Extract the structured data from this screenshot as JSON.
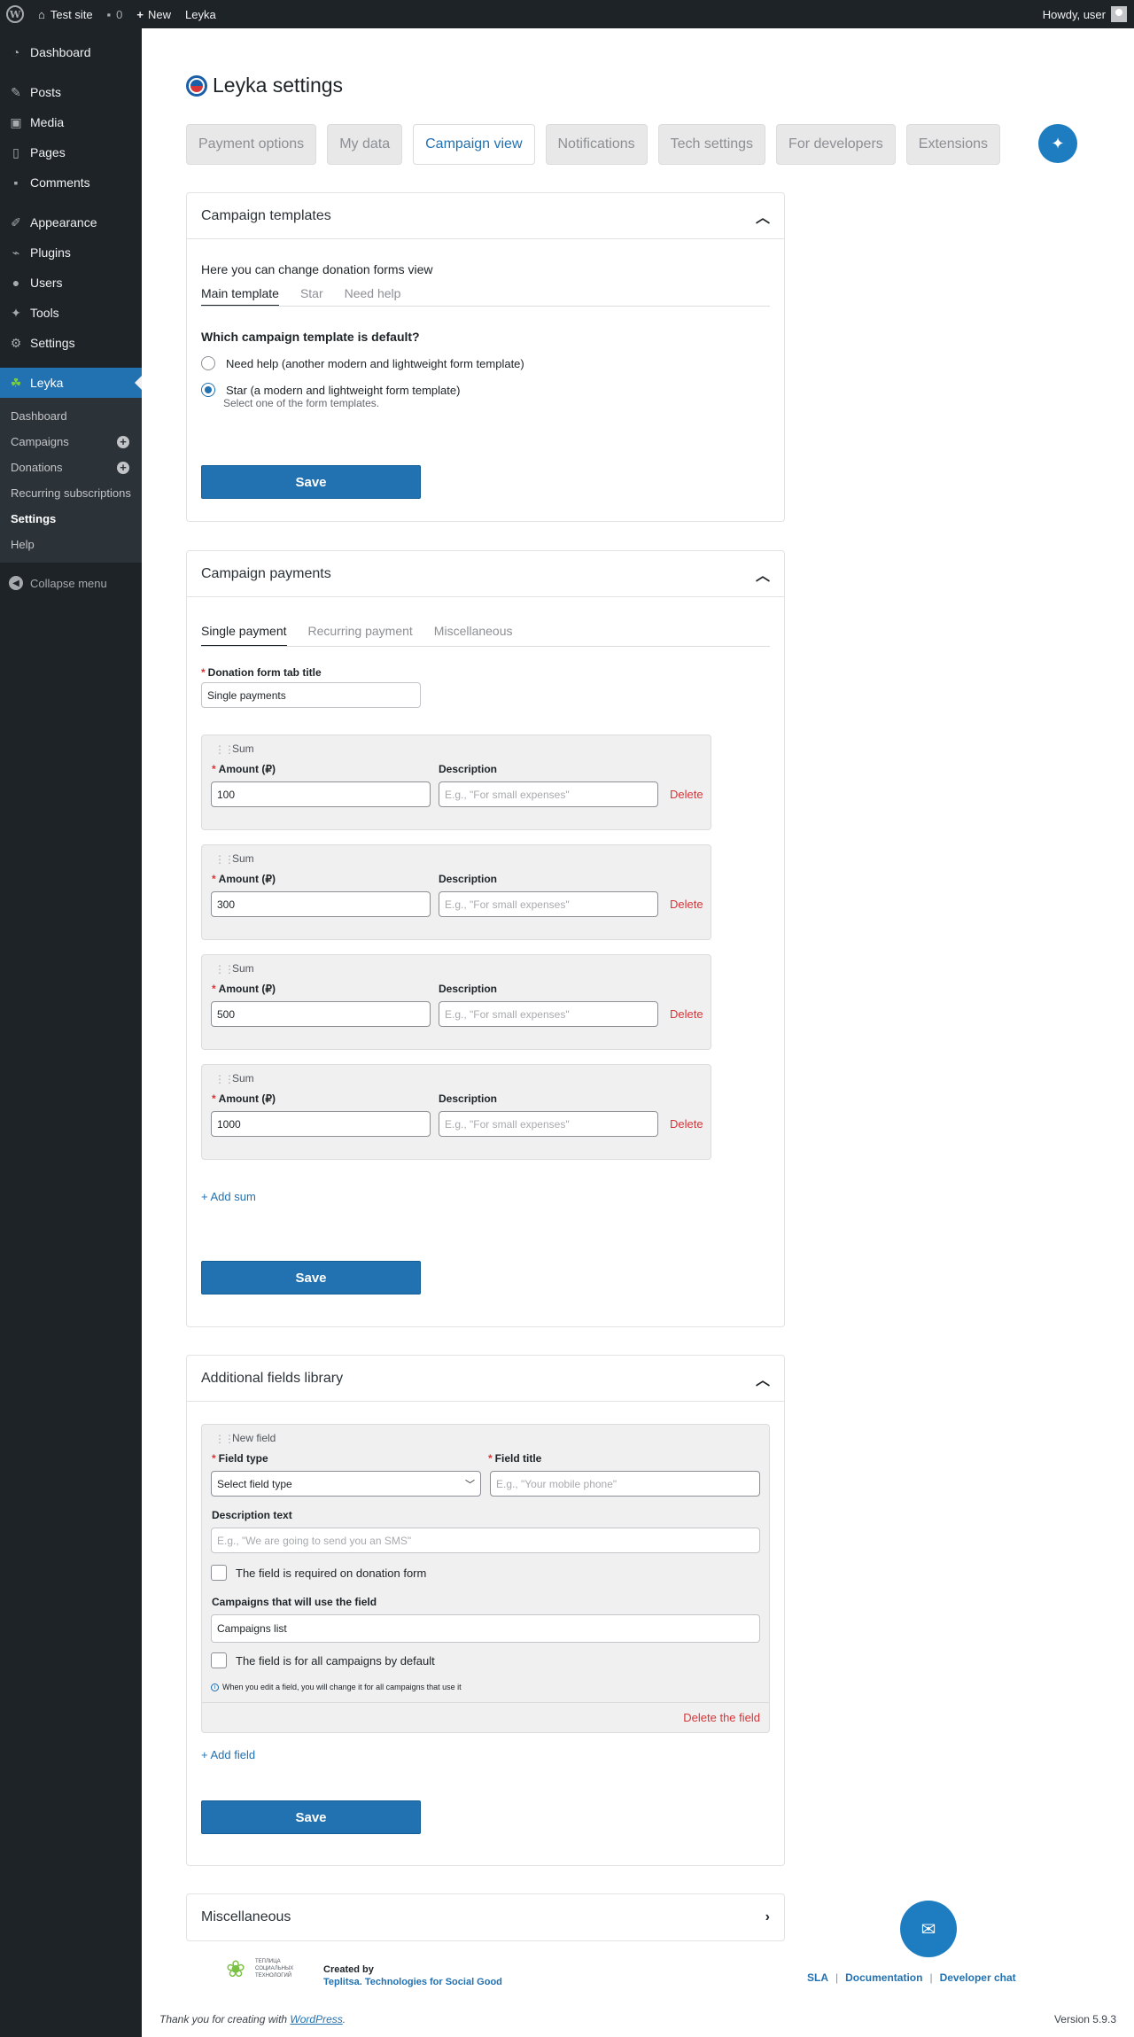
{
  "adminbar": {
    "site_name": "Test site",
    "comments_count": "0",
    "new_label": "New",
    "plugin_label": "Leyka",
    "howdy": "Howdy, user"
  },
  "sidebar": {
    "items": [
      {
        "label": "Dashboard",
        "icon": "dashboard-icon"
      },
      {
        "label": "Posts",
        "icon": "pin-icon"
      },
      {
        "label": "Media",
        "icon": "media-icon"
      },
      {
        "label": "Pages",
        "icon": "page-icon"
      },
      {
        "label": "Comments",
        "icon": "comment-icon"
      },
      {
        "label": "Appearance",
        "icon": "brush-icon"
      },
      {
        "label": "Plugins",
        "icon": "plug-icon"
      },
      {
        "label": "Users",
        "icon": "user-icon"
      },
      {
        "label": "Tools",
        "icon": "wrench-icon"
      },
      {
        "label": "Settings",
        "icon": "settings-icon"
      }
    ],
    "current": {
      "label": "Leyka",
      "icon": "leaf-icon"
    },
    "submenu": [
      "Dashboard",
      "Campaigns",
      "Donations",
      "Recurring subscriptions",
      "Settings",
      "Help"
    ],
    "collapse": "Collapse menu"
  },
  "page": {
    "title": "Leyka settings",
    "tabs": [
      "Payment options",
      "My data",
      "Campaign view",
      "Notifications",
      "Tech settings",
      "For developers",
      "Extensions"
    ],
    "active_tab": "Campaign view"
  },
  "templates": {
    "title": "Campaign templates",
    "intro": "Here you can change donation forms view",
    "subtabs": [
      "Main template",
      "Star",
      "Need help"
    ],
    "question": "Which campaign template is default?",
    "options": [
      "Need help (another modern and lightweight form template)",
      "Star (a modern and lightweight form template)"
    ],
    "selected_index": 1,
    "hint": "Select one of the form templates.",
    "save": "Save"
  },
  "payments": {
    "title": "Campaign payments",
    "subtabs": [
      "Single payment",
      "Recurring payment",
      "Miscellaneous"
    ],
    "tab_title_label": "Donation form tab title",
    "tab_title_value": "Single payments",
    "sum_title": "Sum",
    "amount_label": "Amount (₽)",
    "description_label": "Description",
    "description_placeholder": "E.g., \"For small expenses\"",
    "delete_label": "Delete",
    "amounts": [
      "100",
      "300",
      "500",
      "1000"
    ],
    "add_sum": "+ Add sum",
    "save": "Save"
  },
  "fields": {
    "title": "Additional fields library",
    "new_field": "New field",
    "type_label": "Field type",
    "type_value": "Select field type",
    "title_label": "Field title",
    "title_placeholder": "E.g., \"Your mobile phone\"",
    "desc_label": "Description text",
    "desc_placeholder": "E.g., \"We are going to send you an SMS\"",
    "required_label": "The field is required on donation form",
    "campaigns_label": "Campaigns that will use the field",
    "campaigns_value": "Campaigns list",
    "all_campaigns_label": "The field is for all campaigns by default",
    "notice": "When you edit a field, you will change it for all campaigns that use it",
    "delete_field": "Delete the field",
    "add_field": "+ Add field",
    "save": "Save"
  },
  "misc": {
    "title": "Miscellaneous"
  },
  "footer": {
    "logo_text": [
      "ТЕПЛИЦА",
      "СОЦИАЛЬНЫХ",
      "ТЕХНОЛОГИЙ"
    ],
    "created_by": "Created by",
    "creator": "Teplitsa. Technologies for Social Good",
    "links": [
      "SLA",
      "Documentation",
      "Developer chat"
    ],
    "thanks_prefix": "Thank you for creating with ",
    "thanks_link": "WordPress",
    "thanks_suffix": ".",
    "version": "Version 5.9.3"
  },
  "colors": {
    "accent": "#2271b1",
    "danger": "#d63638",
    "sidebar_bg": "#1d2327"
  }
}
